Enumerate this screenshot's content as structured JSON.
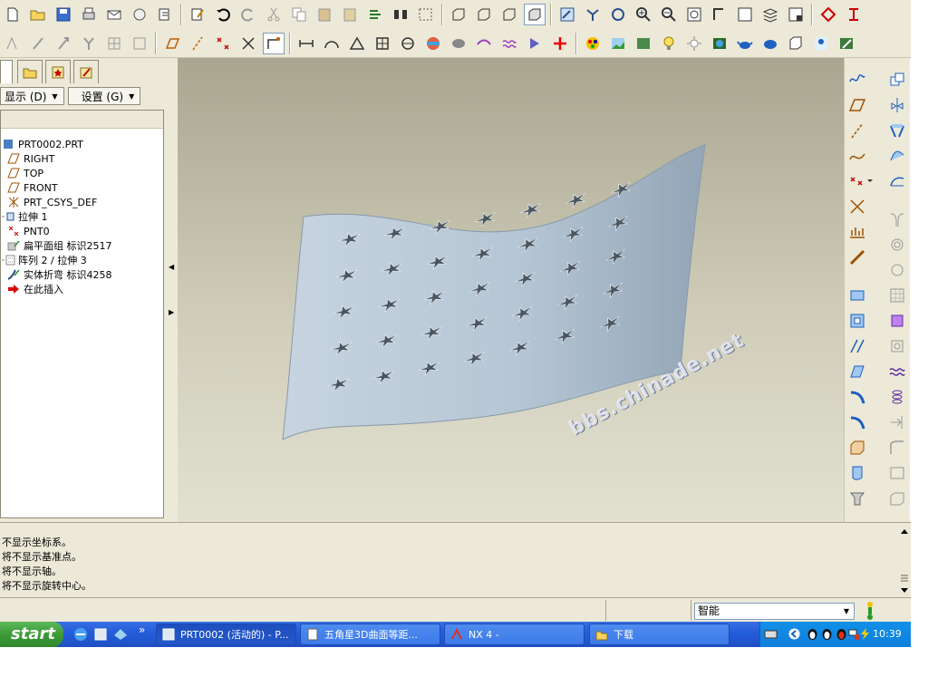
{
  "panel": {
    "menu_show": "显示 (D)",
    "menu_settings": "设置 (G)"
  },
  "tree": {
    "items": [
      {
        "label": "PRT0002.PRT",
        "icon": "part-icon"
      },
      {
        "label": "RIGHT",
        "icon": "datum-plane-icon"
      },
      {
        "label": "TOP",
        "icon": "datum-plane-icon"
      },
      {
        "label": "FRONT",
        "icon": "datum-plane-icon"
      },
      {
        "label": "PRT_CSYS_DEF",
        "icon": "coordinate-system-icon"
      },
      {
        "label": "拉伸 1",
        "icon": "extrude-icon"
      },
      {
        "label": "PNT0",
        "icon": "datum-point-icon"
      },
      {
        "label": "扁平面组 标识2517",
        "icon": "flatten-quilt-icon"
      },
      {
        "label": "阵列 2 / 拉伸 3",
        "icon": "pattern-icon"
      },
      {
        "label": "实体折弯 标识4258",
        "icon": "solid-bend-icon"
      },
      {
        "label": "在此插入",
        "icon": "insert-here-arrow-icon"
      }
    ]
  },
  "viewport": {
    "watermark": "bbs.chinade.net",
    "surface_color": "#b4c4d2",
    "background_color": "#bdbba5"
  },
  "messages": [
    "不显示坐标系。",
    "将不显示基准点。",
    "将不显示轴。",
    "将不显示旋转中心。"
  ],
  "status": {
    "filter_value": "智能"
  },
  "taskbar": {
    "start_label": "start",
    "tasks": [
      {
        "label": "PRT0002 (活动的) - P..."
      },
      {
        "label": "五角星3D曲面等距..."
      },
      {
        "label": "NX 4 -"
      },
      {
        "label": "下载"
      }
    ],
    "clock": "10:39"
  },
  "colors": {
    "chrome": "#ece9d8",
    "taskbar_blue": "#245edb",
    "start_green": "#3c9a37",
    "tray_blue": "#0f7fdc"
  }
}
